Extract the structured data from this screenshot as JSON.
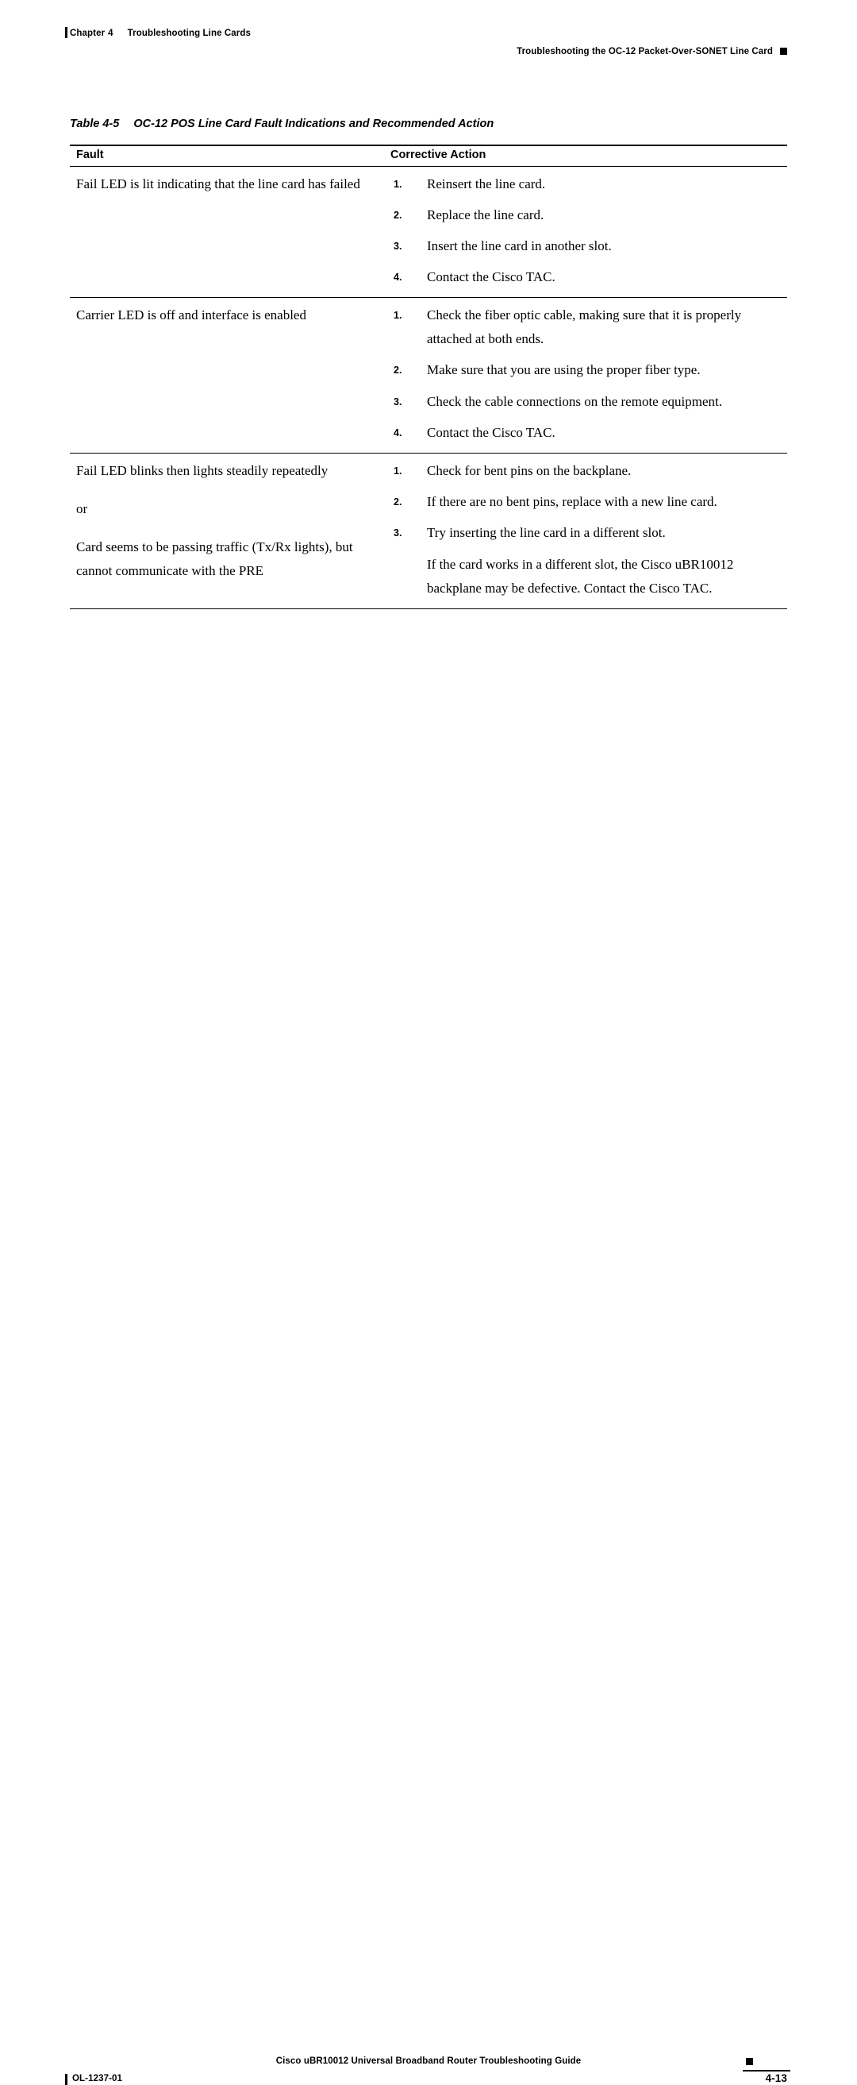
{
  "header": {
    "chapter_label": "Chapter",
    "chapter_number": "4",
    "chapter_title": "Troubleshooting Line Cards",
    "section_title": "Troubleshooting the OC-12 Packet-Over-SONET Line Card"
  },
  "table_caption": {
    "label": "Table 4-5",
    "title": "OC-12 POS Line Card Fault Indications and Recommended Action"
  },
  "table": {
    "headers": {
      "fault": "Fault",
      "corrective_action": "Corrective Action"
    },
    "rows": [
      {
        "fault_lines": [
          "Fail LED is lit indicating that the line card has failed"
        ],
        "steps": [
          "Reinsert the line card.",
          "Replace the line card.",
          "Insert the line card in another slot.",
          "Contact the Cisco TAC."
        ],
        "trailing_paragraph": ""
      },
      {
        "fault_lines": [
          "Carrier LED is off and interface is enabled"
        ],
        "steps": [
          "Check the fiber optic cable, making sure that it is properly attached at both ends.",
          "Make sure that you are using the proper fiber type.",
          "Check the cable connections on the remote equipment.",
          "Contact the Cisco TAC."
        ],
        "trailing_paragraph": ""
      },
      {
        "fault_lines": [
          "Fail LED blinks then lights steadily repeatedly",
          "or",
          "Card seems to be passing traffic (Tx/Rx lights), but cannot communicate with the PRE"
        ],
        "steps": [
          "Check for bent pins on the backplane.",
          "If there are no bent pins, replace with a new line card.",
          "Try inserting the line card in a different slot."
        ],
        "trailing_paragraph": "If the card works in a different slot, the Cisco uBR10012 backplane may be defective. Contact the Cisco TAC."
      }
    ]
  },
  "footer": {
    "document_title": "Cisco uBR10012 Universal Broadband Router Troubleshooting Guide",
    "doc_id": "OL-1237-01",
    "page_number": "4-13"
  }
}
